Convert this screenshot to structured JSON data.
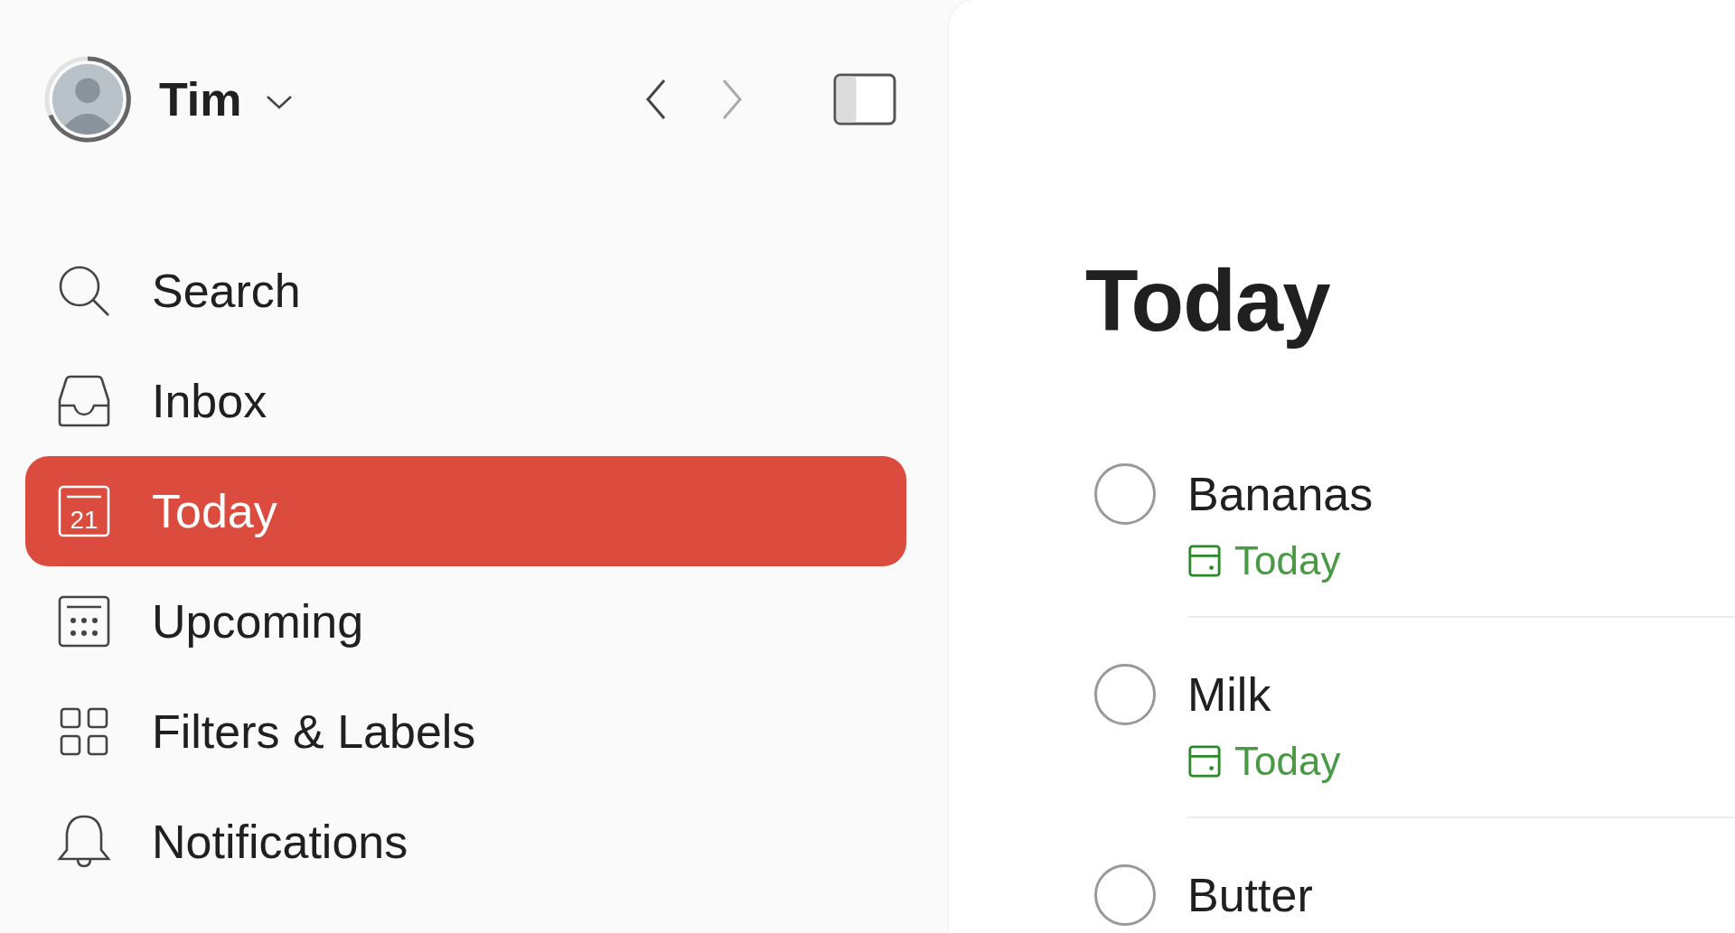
{
  "user": {
    "name": "Tim"
  },
  "history": {
    "back_enabled": true,
    "forward_enabled": false
  },
  "nav": [
    {
      "kind": "search",
      "label": "Search",
      "selected": false
    },
    {
      "kind": "inbox",
      "label": "Inbox",
      "selected": false
    },
    {
      "kind": "today",
      "label": "Today",
      "icon_text": "21",
      "selected": true
    },
    {
      "kind": "upcoming",
      "label": "Upcoming",
      "selected": false
    },
    {
      "kind": "filters",
      "label": "Filters & Labels",
      "selected": false
    },
    {
      "kind": "notifications",
      "label": "Notifications",
      "selected": false
    }
  ],
  "page": {
    "title": "Today"
  },
  "tasks": [
    {
      "title": "Bananas",
      "due": "Today",
      "checked": false
    },
    {
      "title": "Milk",
      "due": "Today",
      "checked": false
    },
    {
      "title": "Butter",
      "checked": false
    }
  ]
}
